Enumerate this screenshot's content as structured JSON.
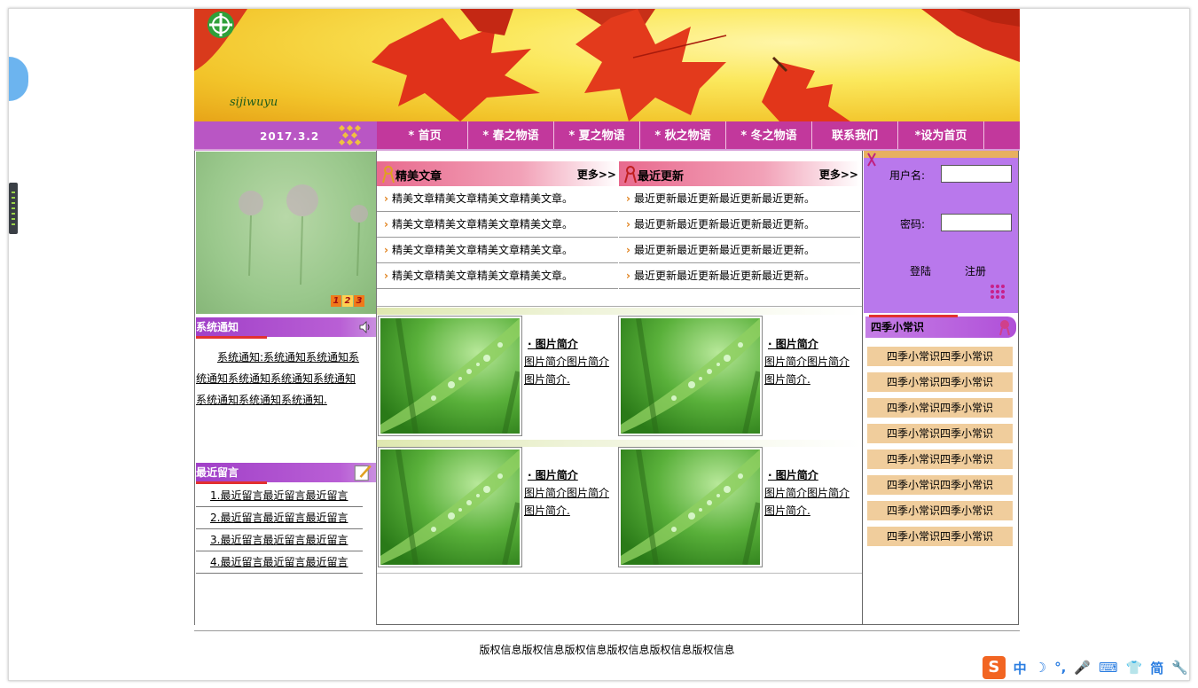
{
  "header": {
    "logo_text": "sijiwuyu",
    "date": "2017.3.2"
  },
  "nav": {
    "items": [
      {
        "label": "* 首页"
      },
      {
        "label": "* 春之物语"
      },
      {
        "label": "* 夏之物语"
      },
      {
        "label": "* 秋之物语"
      },
      {
        "label": "* 冬之物语"
      },
      {
        "label": "联系我们"
      },
      {
        "label": "*设为首页"
      }
    ]
  },
  "slideshow": {
    "numbers": [
      "1",
      "2",
      "3"
    ]
  },
  "notice": {
    "title": "系统通知",
    "body": "系统通知:系统通知系统通知系统通知系统通知系统通知系统通知系统通知系统通知系统通知."
  },
  "messages": {
    "title": "最近留言",
    "items": [
      "1.最近留言最近留言最近留言",
      "2.最近留言最近留言最近留言",
      "3.最近留言最近留言最近留言",
      "4.最近留言最近留言最近留言"
    ]
  },
  "articles": {
    "title": "精美文章",
    "more": "更多>>",
    "items": [
      "精美文章精美文章精美文章精美文章。",
      "精美文章精美文章精美文章精美文章。",
      "精美文章精美文章精美文章精美文章。",
      "精美文章精美文章精美文章精美文章。"
    ]
  },
  "updates": {
    "title": "最近更新",
    "more": "更多>>",
    "items": [
      "最近更新最近更新最近更新最近更新。",
      "最近更新最近更新最近更新最近更新。",
      "最近更新最近更新最近更新最近更新。",
      "最近更新最近更新最近更新最近更新。"
    ]
  },
  "pictures": [
    {
      "title": "· 图片简介",
      "desc": "图片简介图片简介图片简介."
    },
    {
      "title": "· 图片简介",
      "desc": "图片简介图片简介图片简介."
    },
    {
      "title": "· 图片简介",
      "desc": "图片简介图片简介图片简介."
    },
    {
      "title": "· 图片简介",
      "desc": "图片简介图片简介图片简介."
    }
  ],
  "login": {
    "username_label": "用户名:",
    "password_label": "密码:",
    "login_button": "登陆",
    "register_button": "注册"
  },
  "tips": {
    "title": "四季小常识",
    "items": [
      "四季小常识四季小常识",
      "四季小常识四季小常识",
      "四季小常识四季小常识",
      "四季小常识四季小常识",
      "四季小常识四季小常识",
      "四季小常识四季小常识",
      "四季小常识四季小常识",
      "四季小常识四季小常识"
    ]
  },
  "footer": {
    "copyright": "版权信息版权信息版权信息版权信息版权信息版权信息"
  },
  "ime": {
    "logo": "S",
    "items": [
      "中",
      "☽",
      "°,",
      "🎤",
      "⌨",
      "👕",
      "简",
      "🔧"
    ]
  },
  "colors": {
    "nav_bg": "#c2389c",
    "date_bg": "#b956c4",
    "login_bg": "#b978ec",
    "tip_bg": "#f0cd9c",
    "section_head": "#a140c8"
  }
}
